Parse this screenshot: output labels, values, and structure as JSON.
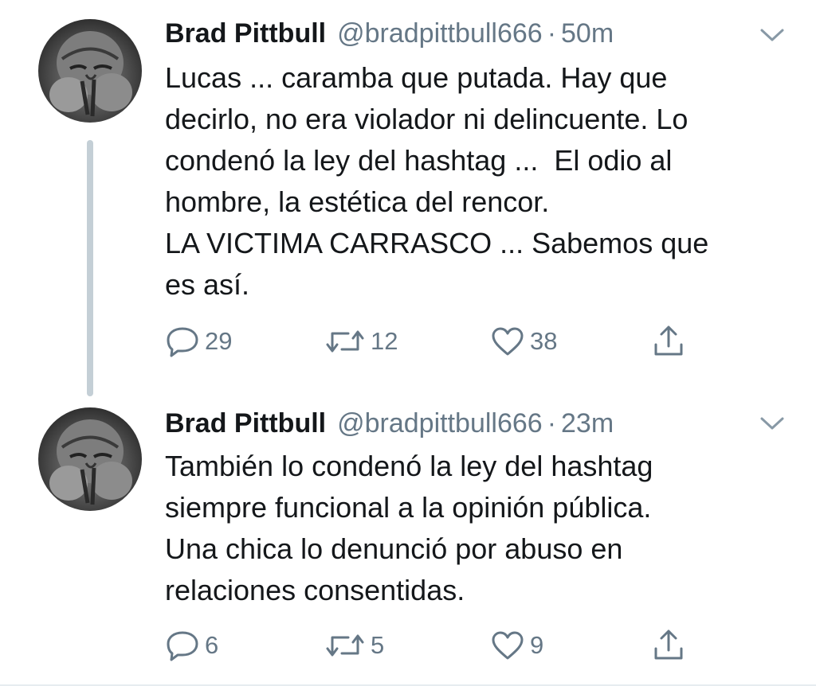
{
  "tweets": [
    {
      "display_name": "Brad Pittbull",
      "handle": "@bradpittbull666",
      "separator": "·",
      "time": "50m",
      "text": "Lucas ... caramba que putada. Hay que\ndecirlo, no era violador ni delincuente. Lo\ncondenó la ley del hashtag ...  El odio al\nhombre, la estética del rencor.\nLA VICTIMA CARRASCO ... Sabemos que\nes así.",
      "replies": "29",
      "retweets": "12",
      "likes": "38"
    },
    {
      "display_name": "Brad Pittbull",
      "handle": "@bradpittbull666",
      "separator": "·",
      "time": "23m",
      "text": "También lo condenó la ley del hashtag\nsiempre funcional a la opinión pública.\nUna chica lo denunció por abuso en\nrelaciones consentidas.",
      "replies": "6",
      "retweets": "5",
      "likes": "9"
    }
  ],
  "icons": {
    "reply": "reply-icon",
    "retweet": "retweet-icon",
    "like": "heart-icon",
    "share": "share-icon",
    "caret": "chevron-down-icon"
  },
  "colors": {
    "text": "#14171a",
    "secondary": "#657786",
    "thread_line": "#c4cfd6"
  }
}
